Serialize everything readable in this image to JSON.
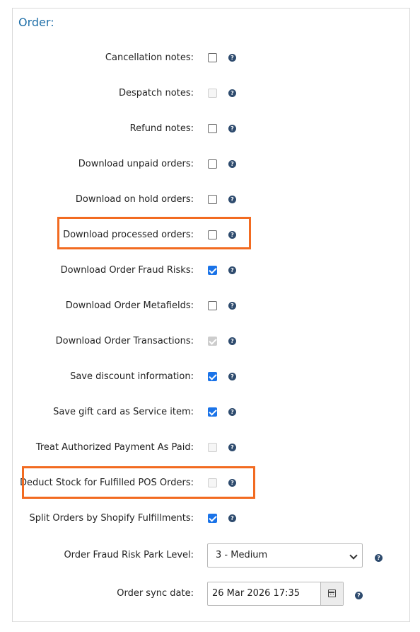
{
  "section": {
    "title": "Order:"
  },
  "rows": [
    {
      "label": "Cancellation notes:",
      "checked": false,
      "disabled": false
    },
    {
      "label": "Despatch notes:",
      "checked": false,
      "disabled": true
    },
    {
      "label": "Refund notes:",
      "checked": false,
      "disabled": false
    },
    {
      "label": "Download unpaid orders:",
      "checked": false,
      "disabled": false
    },
    {
      "label": "Download on hold orders:",
      "checked": false,
      "disabled": false
    },
    {
      "label": "Download processed orders:",
      "checked": false,
      "disabled": false,
      "highlighted": true
    },
    {
      "label": "Download Order Fraud Risks:",
      "checked": true,
      "disabled": false
    },
    {
      "label": "Download Order Metafields:",
      "checked": false,
      "disabled": false
    },
    {
      "label": "Download Order Transactions:",
      "checked": true,
      "disabled": true
    },
    {
      "label": "Save discount information:",
      "checked": true,
      "disabled": false
    },
    {
      "label": "Save gift card as Service item:",
      "checked": true,
      "disabled": false
    },
    {
      "label": "Treat Authorized Payment As Paid:",
      "checked": false,
      "disabled": true
    },
    {
      "label": "Deduct Stock for Fulfilled POS Orders:",
      "checked": false,
      "disabled": true,
      "highlighted": true
    },
    {
      "label": "Split Orders by Shopify Fulfillments:",
      "checked": true,
      "disabled": false
    }
  ],
  "fraud_risk": {
    "label": "Order Fraud Risk Park Level:",
    "value": "3 - Medium"
  },
  "sync_date": {
    "label": "Order sync date:",
    "value": "26 Mar 2026 17:35"
  },
  "help_glyph": "?",
  "colors": {
    "title": "#1f6fa8",
    "highlight": "#f26b21",
    "checkbox_checked": "#1a73e8",
    "help_icon": "#2e4b6e"
  }
}
